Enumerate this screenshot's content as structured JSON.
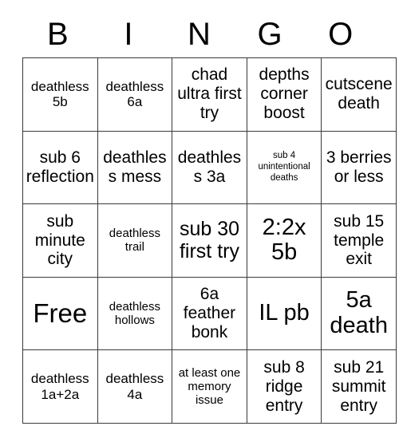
{
  "card": {
    "title": "BINGO",
    "header_letters": [
      "B",
      "I",
      "N",
      "G",
      "O"
    ],
    "free_space_label": "Free",
    "border_color": "#3a3a3a",
    "background_color": "#ffffff",
    "text_color": "#000000",
    "rows": [
      [
        {
          "text": "deathless 5b",
          "size": "md"
        },
        {
          "text": "deathless 6a",
          "size": "md"
        },
        {
          "text": "chad ultra first try",
          "size": "lg"
        },
        {
          "text": "depths corner boost",
          "size": "lg"
        },
        {
          "text": "cutscene death",
          "size": "lg"
        }
      ],
      [
        {
          "text": "sub 6 reflection",
          "size": "lg"
        },
        {
          "text": "deathless mess",
          "size": "lg"
        },
        {
          "text": "deathless 3a",
          "size": "lg"
        },
        {
          "text": "sub 4 unintentional deaths",
          "size": "xs"
        },
        {
          "text": "3 berries or less",
          "size": "lg"
        }
      ],
      [
        {
          "text": "sub minute city",
          "size": "lg"
        },
        {
          "text": "deathless trail",
          "size": "sm"
        },
        {
          "text": "sub 30 first try",
          "size": "xl"
        },
        {
          "text": "2:2x 5b",
          "size": "xxl"
        },
        {
          "text": "sub 15 temple exit",
          "size": "lg"
        }
      ],
      [
        {
          "text": "Free",
          "size": "huge"
        },
        {
          "text": "deathless hollows",
          "size": "sm"
        },
        {
          "text": "6a feather bonk",
          "size": "lg"
        },
        {
          "text": "IL pb",
          "size": "xxl"
        },
        {
          "text": "5a death",
          "size": "xxl"
        }
      ],
      [
        {
          "text": "deathless 1a+2a",
          "size": "md"
        },
        {
          "text": "deathless 4a",
          "size": "md"
        },
        {
          "text": "at least one memory issue",
          "size": "sm"
        },
        {
          "text": "sub 8 ridge entry",
          "size": "lg"
        },
        {
          "text": "sub 21 summit entry",
          "size": "lg"
        }
      ]
    ]
  }
}
